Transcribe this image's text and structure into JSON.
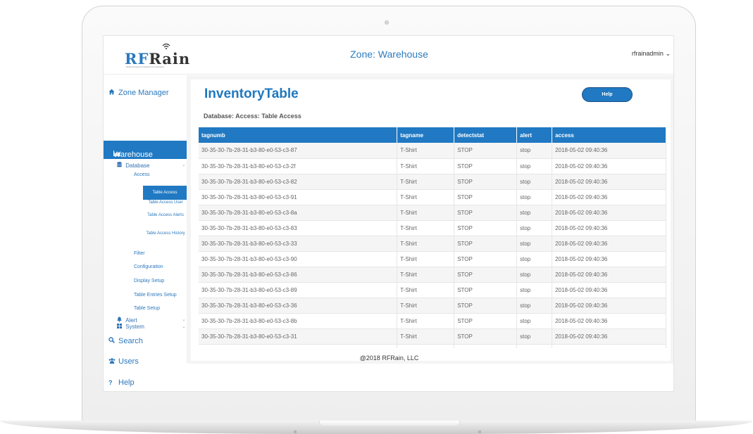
{
  "header": {
    "logo_rf": "RF",
    "logo_rain": "Rain",
    "logo_tagline": "Radio Frequency Research & Innovation",
    "zone_title": "Zone: Warehouse",
    "user": "rfrainadmin",
    "user_chevron": "⌄"
  },
  "sidebar": {
    "zone_manager": "Zone Manager",
    "warehouse": "Warehouse",
    "database": "Database",
    "access": "Access",
    "table_access": "Table Access",
    "table_access_user": "Table Access User",
    "table_access_alerts": "Table Access Alerts",
    "table_access_history": "Table Access History",
    "filter": "Filter",
    "configuration": "Configuration",
    "display_setup": "Display Setup",
    "table_entries_setup": "Table Entries Setup",
    "table_setup": "Table Setup",
    "alert": "Alert",
    "system": "System",
    "search": "Search",
    "users": "Users",
    "help": "Help"
  },
  "main": {
    "title": "InventoryTable",
    "help_button": "Help",
    "subtitle": "Database: Access: Table Access",
    "columns": [
      "tagnumb",
      "tagname",
      "detectstat",
      "alert",
      "access"
    ],
    "rows": [
      [
        "30-35-30-7b-28-31-b3-80-e0-53-c3-87",
        "T-Shirt",
        "STOP",
        "stop",
        "2018-05-02 09:40:36"
      ],
      [
        "30-35-30-7b-28-31-b3-80-e0-53-c3-2f",
        "T-Shirt",
        "STOP",
        "stop",
        "2018-05-02 09:40:36"
      ],
      [
        "30-35-30-7b-28-31-b3-80-e0-53-c3-82",
        "T-Shirt",
        "STOP",
        "stop",
        "2018-05-02 09:40:36"
      ],
      [
        "30-35-30-7b-28-31-b3-80-e0-53-c3-91",
        "T-Shirt",
        "STOP",
        "stop",
        "2018-05-02 09:40:36"
      ],
      [
        "30-35-30-7b-28-31-b3-80-e0-53-c3-8a",
        "T-Shirt",
        "STOP",
        "stop",
        "2018-05-02 09:40:36"
      ],
      [
        "30-35-30-7b-28-31-b3-80-e0-53-c3-83",
        "T-Shirt",
        "STOP",
        "stop",
        "2018-05-02 09:40:36"
      ],
      [
        "30-35-30-7b-28-31-b3-80-e0-53-c3-33",
        "T-Shirt",
        "STOP",
        "stop",
        "2018-05-02 09:40:36"
      ],
      [
        "30-35-30-7b-28-31-b3-80-e0-53-c3-90",
        "T-Shirt",
        "STOP",
        "stop",
        "2018-05-02 09:40:36"
      ],
      [
        "30-35-30-7b-28-31-b3-80-e0-53-c3-86",
        "T-Shirt",
        "STOP",
        "stop",
        "2018-05-02 09:40:36"
      ],
      [
        "30-35-30-7b-28-31-b3-80-e0-53-c3-89",
        "T-Shirt",
        "STOP",
        "stop",
        "2018-05-02 09:40:36"
      ],
      [
        "30-35-30-7b-28-31-b3-80-e0-53-c3-36",
        "T-Shirt",
        "STOP",
        "stop",
        "2018-05-02 09:40:36"
      ],
      [
        "30-35-30-7b-28-31-b3-80-e0-53-c3-8b",
        "T-Shirt",
        "STOP",
        "stop",
        "2018-05-02 09:40:36"
      ],
      [
        "30-35-30-7b-28-31-b3-80-e0-53-c3-31",
        "T-Shirt",
        "STOP",
        "stop",
        "2018-05-02 09:40:36"
      ],
      [
        "",
        "",
        "",
        "",
        ""
      ]
    ]
  },
  "footer": {
    "copyright": "@2018 RFRain, LLC"
  },
  "colors": {
    "accent": "#2079c2",
    "link": "#2c79bd",
    "title": "#1f78bf"
  },
  "icons": {
    "zone_manager": "home-icon",
    "warehouse": "area-chart-icon",
    "database": "database-icon",
    "alert": "bell-icon",
    "system": "windows-icon",
    "search": "search-icon",
    "users": "users-icon",
    "help": "question-icon"
  }
}
